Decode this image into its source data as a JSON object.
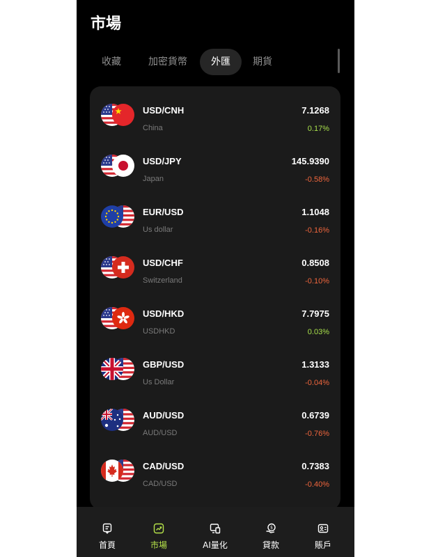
{
  "page": {
    "title": "市場"
  },
  "tabs": [
    {
      "label": "收藏",
      "active": false
    },
    {
      "label": "加密貨幣",
      "active": false
    },
    {
      "label": "外匯",
      "active": true
    },
    {
      "label": "期貨",
      "active": false
    }
  ],
  "colors": {
    "up": "#a8e04b",
    "down": "#f0663d",
    "accent": "#b6e34a",
    "card": "#1b1b1b"
  },
  "markets": [
    {
      "pair": "USD/CNH",
      "name": "China",
      "price": "7.1268",
      "change": "0.17%",
      "direction": "up",
      "base_flag": "flag-us",
      "quote_flag": "flag-cn"
    },
    {
      "pair": "USD/JPY",
      "name": "Japan",
      "price": "145.9390",
      "change": "-0.58%",
      "direction": "down",
      "base_flag": "flag-us",
      "quote_flag": "flag-jp"
    },
    {
      "pair": "EUR/USD",
      "name": "Us dollar",
      "price": "1.1048",
      "change": "-0.16%",
      "direction": "down",
      "base_flag": "flag-eu",
      "quote_flag": "flag-us"
    },
    {
      "pair": "USD/CHF",
      "name": "Switzerland",
      "price": "0.8508",
      "change": "-0.10%",
      "direction": "down",
      "base_flag": "flag-us",
      "quote_flag": "flag-ch"
    },
    {
      "pair": "USD/HKD",
      "name": "USDHKD",
      "price": "7.7975",
      "change": "0.03%",
      "direction": "up",
      "base_flag": "flag-us",
      "quote_flag": "flag-hk"
    },
    {
      "pair": "GBP/USD",
      "name": "Us Dollar",
      "price": "1.3133",
      "change": "-0.04%",
      "direction": "down",
      "base_flag": "flag-gb",
      "quote_flag": "flag-us"
    },
    {
      "pair": "AUD/USD",
      "name": "AUD/USD",
      "price": "0.6739",
      "change": "-0.76%",
      "direction": "down",
      "base_flag": "flag-au",
      "quote_flag": "flag-us"
    },
    {
      "pair": "CAD/USD",
      "name": "CAD/USD",
      "price": "0.7383",
      "change": "-0.40%",
      "direction": "down",
      "base_flag": "flag-ca",
      "quote_flag": "flag-us"
    }
  ],
  "bottom_nav": [
    {
      "label": "首頁",
      "icon": "home-icon",
      "active": false
    },
    {
      "label": "市場",
      "icon": "chart-trend-icon",
      "active": true
    },
    {
      "label": "AI量化",
      "icon": "ai-quant-icon",
      "active": false
    },
    {
      "label": "貸款",
      "icon": "loan-icon",
      "active": false
    },
    {
      "label": "賬戶",
      "icon": "account-icon",
      "active": false
    }
  ]
}
